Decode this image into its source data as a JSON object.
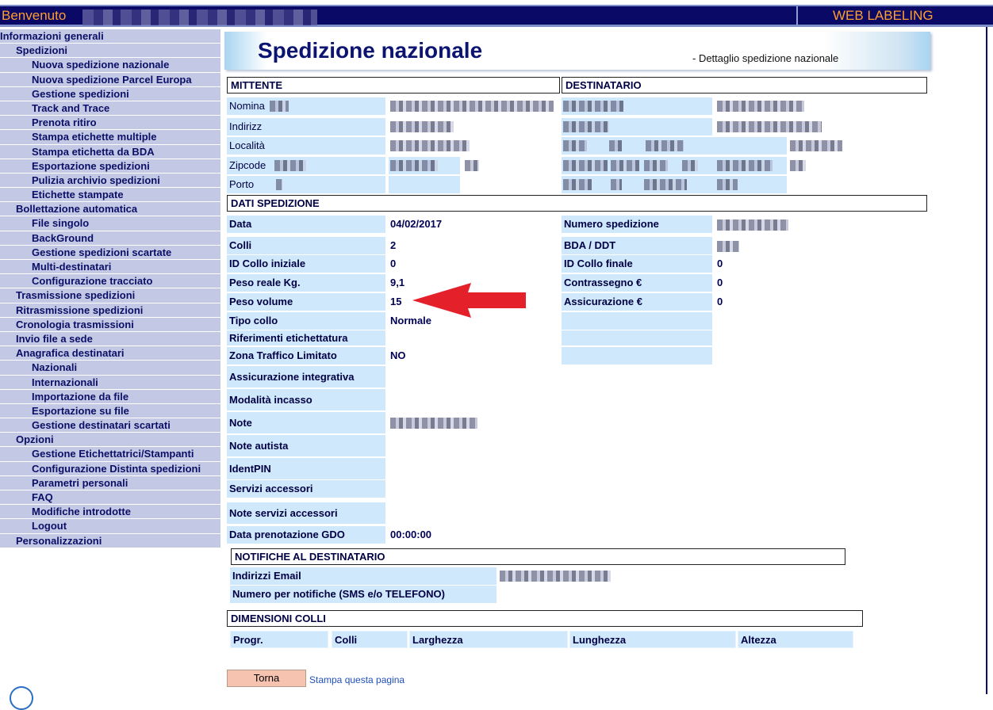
{
  "header": {
    "welcome": "Benvenuto",
    "app_title": "WEB LABELING"
  },
  "sidebar": {
    "items": [
      {
        "label": "Informazioni generali",
        "level": 0
      },
      {
        "label": "Spedizioni",
        "level": 1
      },
      {
        "label": "Nuova spedizione nazionale",
        "level": 2
      },
      {
        "label": "Nuova spedizione Parcel Europa",
        "level": 2
      },
      {
        "label": "Gestione spedizioni",
        "level": 2
      },
      {
        "label": "Track and Trace",
        "level": 2
      },
      {
        "label": "Prenota ritiro",
        "level": 2
      },
      {
        "label": "Stampa etichette multiple",
        "level": 2
      },
      {
        "label": "Stampa etichetta da BDA",
        "level": 2
      },
      {
        "label": "Esportazione spedizioni",
        "level": 2
      },
      {
        "label": "Pulizia archivio spedizioni",
        "level": 2
      },
      {
        "label": "Etichette stampate",
        "level": 2
      },
      {
        "label": "Bollettazione automatica",
        "level": 1
      },
      {
        "label": "File singolo",
        "level": 2
      },
      {
        "label": "BackGround",
        "level": 2
      },
      {
        "label": "Gestione spedizioni scartate",
        "level": 2
      },
      {
        "label": "Multi-destinatari",
        "level": 2
      },
      {
        "label": "Configurazione tracciato",
        "level": 2
      },
      {
        "label": "Trasmissione spedizioni",
        "level": 1
      },
      {
        "label": "Ritrasmissione spedizioni",
        "level": 1
      },
      {
        "label": "Cronologia trasmissioni",
        "level": 1
      },
      {
        "label": "Invio file a sede",
        "level": 1
      },
      {
        "label": "Anagrafica destinatari",
        "level": 1
      },
      {
        "label": "Nazionali",
        "level": 2
      },
      {
        "label": "Internazionali",
        "level": 2
      },
      {
        "label": "Importazione da file",
        "level": 2
      },
      {
        "label": "Esportazione su file",
        "level": 2
      },
      {
        "label": "Gestione destinatari scartati",
        "level": 2
      },
      {
        "label": "Opzioni",
        "level": 1
      },
      {
        "label": "Gestione Etichettatrici/Stampanti",
        "level": 2
      },
      {
        "label": "Configurazione Distinta spedizioni",
        "level": 2
      },
      {
        "label": "Parametri personali",
        "level": 2
      },
      {
        "label": "FAQ",
        "level": 2
      },
      {
        "label": "Modifiche introdotte",
        "level": 2
      },
      {
        "label": "Logout",
        "level": 2
      },
      {
        "label": "Personalizzazioni",
        "level": 1
      }
    ]
  },
  "banner": {
    "title": "Spedizione nazionale",
    "subtitle": "- Dettaglio spedizione nazionale"
  },
  "mittente": {
    "header": "MITTENTE",
    "labels": [
      "Nomina",
      "Indirizz",
      "Località",
      "Zipcode",
      "Porto"
    ]
  },
  "destinatario": {
    "header": "DESTINATARIO"
  },
  "dati_spedizione": {
    "header": "DATI SPEDIZIONE",
    "left": [
      {
        "label": "Data",
        "value": "04/02/2017"
      },
      {
        "label": "Colli",
        "value": "2"
      },
      {
        "label": "ID Collo iniziale",
        "value": "0"
      },
      {
        "label": "Peso reale Kg.",
        "value": "9,1"
      },
      {
        "label": "Peso volume",
        "value": "15"
      },
      {
        "label": "Tipo collo",
        "value": "Normale"
      },
      {
        "label": "Riferimenti etichettatura",
        "value": ""
      },
      {
        "label": "Zona Traffico Limitato",
        "value": "NO"
      },
      {
        "label": "Assicurazione integrativa",
        "value": ""
      },
      {
        "label": "Modalità incasso",
        "value": ""
      },
      {
        "label": "Note",
        "value": ""
      },
      {
        "label": "Note autista",
        "value": ""
      },
      {
        "label": "IdentPIN",
        "value": ""
      },
      {
        "label": "Servizi accessori",
        "value": ""
      },
      {
        "label": "Note servizi accessori",
        "value": ""
      },
      {
        "label": "Data prenotazione GDO",
        "value": "00:00:00"
      }
    ],
    "right": [
      {
        "label": "Numero spedizione",
        "value": ""
      },
      {
        "label": "BDA / DDT",
        "value": ""
      },
      {
        "label": "ID Collo finale",
        "value": "0"
      },
      {
        "label": "Contrassegno €",
        "value": "0"
      },
      {
        "label": "Assicurazione  €",
        "value": "0"
      }
    ]
  },
  "notifiche": {
    "header": "NOTIFICHE AL DESTINATARIO",
    "email_label": "Indirizzi Email",
    "sms_label": "Numero per notifiche (SMS e/o TELEFONO)"
  },
  "dimensioni": {
    "header": "DIMENSIONI COLLI",
    "columns": [
      "Progr.",
      "Colli",
      "Larghezza",
      "Lunghezza",
      "Altezza"
    ]
  },
  "actions": {
    "back_label": "Torna",
    "print_label": "Stampa questa pagina"
  },
  "colors": {
    "header_bg": "#0b0966",
    "header_text": "#ff9d2f",
    "nav_bg": "#c3c9e4",
    "cell_bg": "#cfe8fb",
    "arrow": "#e4202a",
    "button_bg": "#f6c3b0"
  }
}
